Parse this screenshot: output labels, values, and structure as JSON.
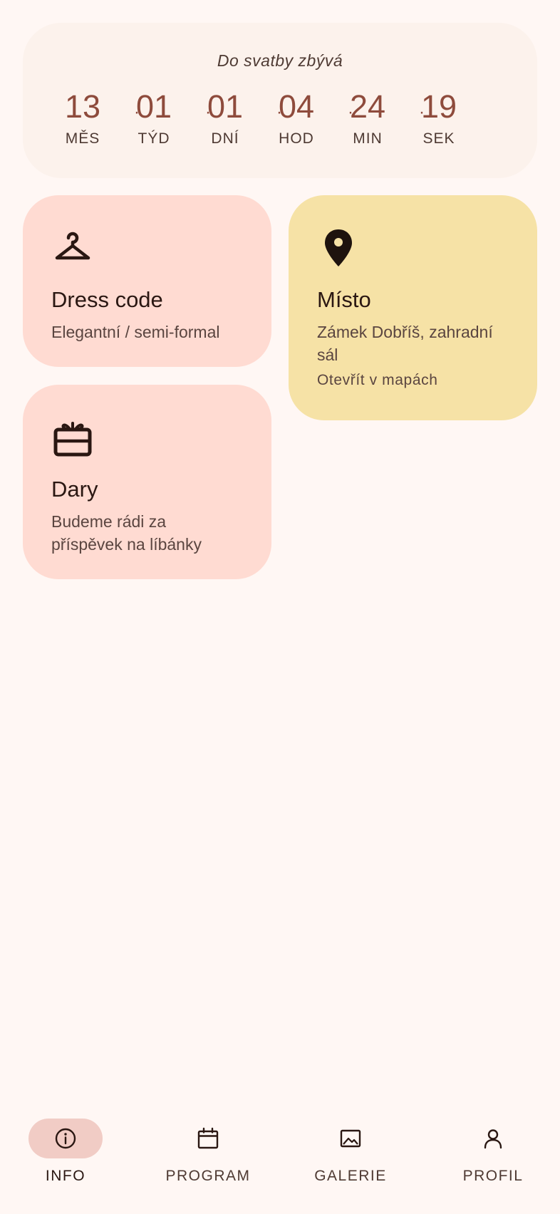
{
  "countdown": {
    "title": "Do svatby zbývá",
    "separator": "·",
    "units": [
      {
        "value": "13",
        "label": "MĚS"
      },
      {
        "value": "01",
        "label": "TÝD"
      },
      {
        "value": "01",
        "label": "DNÍ"
      },
      {
        "value": "04",
        "label": "HOD"
      },
      {
        "value": "24",
        "label": "MIN"
      },
      {
        "value": "19",
        "label": "SEK"
      }
    ]
  },
  "cards": {
    "dress_code": {
      "icon": "hanger-icon",
      "title": "Dress code",
      "subtitle": "Elegantní / semi-formal"
    },
    "venue": {
      "icon": "location-pin-icon",
      "title": "Místo",
      "subtitle": "Zámek Dobříš, zahradní sál",
      "link": "Otevřít v mapách"
    },
    "gifts": {
      "icon": "gift-icon",
      "title": "Dary",
      "subtitle": "Budeme rádi za příspěvek na líbánky"
    }
  },
  "nav": {
    "active": "INFO",
    "items": [
      {
        "label": "INFO",
        "icon": "info-icon"
      },
      {
        "label": "PROGRAM",
        "icon": "calendar-icon"
      },
      {
        "label": "GALERIE",
        "icon": "image-icon"
      },
      {
        "label": "PROFIL",
        "icon": "person-icon"
      }
    ]
  },
  "colors": {
    "background": "#FFF7F4",
    "countdown_card": "#FCF2EC",
    "accent_number": "#8E4B3C",
    "card_pink": "#FFDBD2",
    "card_yellow": "#F6E2A6",
    "nav_active_pill": "#F1CCC5"
  }
}
